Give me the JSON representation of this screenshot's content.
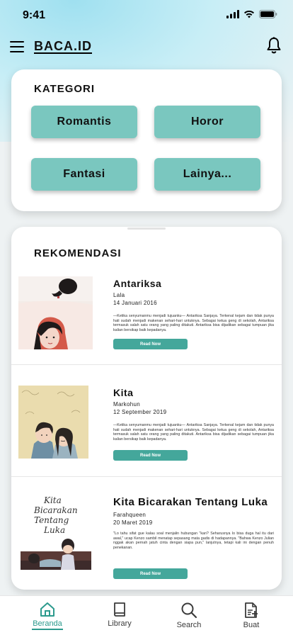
{
  "status_bar": {
    "time": "9:41",
    "icons": [
      "signal-icon",
      "wifi-icon",
      "battery-icon"
    ]
  },
  "header": {
    "brand": "BACA.ID",
    "menu_icon": "menu-icon",
    "bell_icon": "bell-icon"
  },
  "kategori": {
    "title": "KATEGORI",
    "items": [
      {
        "label": "Romantis"
      },
      {
        "label": "Horor"
      },
      {
        "label": "Fantasi"
      },
      {
        "label": "Lainya..."
      }
    ]
  },
  "rekomendasi": {
    "title": "REKOMENDASI",
    "books": [
      {
        "title": "Antariksa",
        "author": "Lala",
        "date": "14 Januari 2016",
        "description": "—Ketika senyumanmu menjadi tujuanku— Antariksa Sanjaya. Terkenal kejam dan tidak punya hati sudah menjadi makenan sehari-hari untuknya. Sebagai ketua geng di sekolah, Antariksa termasuk salah satu orang yang paling ditakuti. Antariksa bisa dijadikan sebagai tumpuan jika kalian bersikap baik kepadanya.",
        "button": "Read Now"
      },
      {
        "title": "Kita",
        "author": "Markohun",
        "date": "12 September 2019",
        "description": "—Ketika senyumanmu menjadi tujuanku— Antariksa Sanjaya. Terkenal kejam dan tidak punya hati sudah menjadi makenan sehari-hari untuknya. Sebagai ketua geng di sekolah, Antariksa termasuk salah satu orang yang paling ditakuti. Antariksa bisa dijadikan sebagai tumpuan jika kalian bersikap baik kepadanya.",
        "button": "Read Now"
      },
      {
        "title": "Kita Bicarakan Tentang Luka",
        "author": "Farahqueen",
        "date": "20 Maret 2019",
        "description": "\"Lo tahu sifat gue kalau soal menjalin hubungan \"kan? Seharusnya lo bisa duga hal itu dari awal,\" ucap Kenzo sambil menatap sepasang mata gadis di hadapannya. \"Bahwa Kenzo Julian nggak akan pernah jatuh cinta dengan siapa pun,\" lanjutnya, tetapi kali ini dengan penuh penekanan.",
        "button": "Read Now",
        "cover_text": [
          "Kita",
          "Bicarakan",
          "Tentang",
          "Luka"
        ]
      }
    ]
  },
  "bottom_nav": {
    "items": [
      {
        "label": "Beranda",
        "icon": "home-icon",
        "active": true
      },
      {
        "label": "Library",
        "icon": "book-icon",
        "active": false
      },
      {
        "label": "Search",
        "icon": "search-icon",
        "active": false
      },
      {
        "label": "Buat",
        "icon": "create-document-icon",
        "active": false
      }
    ]
  },
  "colors": {
    "accent": "#44a79b",
    "category_button": "#7ac7bf",
    "active_nav": "#2c9a8d"
  }
}
